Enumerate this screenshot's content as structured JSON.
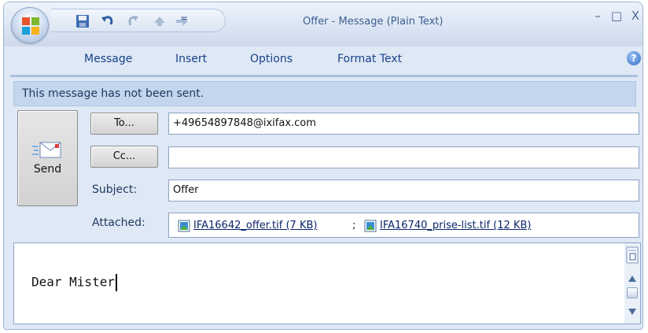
{
  "window": {
    "title": "Offer - Message (Plain Text)",
    "minimize_glyph": "–",
    "maximize_glyph": "□",
    "close_glyph": "X"
  },
  "quick_access": {
    "icons": [
      "save-icon",
      "undo-icon",
      "redo-icon",
      "previous-item-icon",
      "next-item-icon",
      "customize-dropdown-icon"
    ],
    "customize_glyph": "="
  },
  "ribbon": {
    "tabs": [
      {
        "label": "Message"
      },
      {
        "label": "Insert"
      },
      {
        "label": "Options"
      },
      {
        "label": "Format Text"
      }
    ],
    "help_glyph": "?"
  },
  "infobar": {
    "text": "This message has not been sent."
  },
  "send": {
    "label": "Send"
  },
  "to": {
    "button_label": "To...",
    "value": "+49654897848@ixifax.com"
  },
  "cc": {
    "button_label": "Cc...",
    "value": ""
  },
  "subject": {
    "label": "Subject:",
    "value": "Offer"
  },
  "attached": {
    "label": "Attached:",
    "files": [
      {
        "name": "IFA16642_offer.tif (7 KB)"
      },
      {
        "name": "IFA16740_prise-list.tif (12 KB)"
      }
    ],
    "separator": ";"
  },
  "body": {
    "text": "Dear Mister"
  },
  "colors": {
    "window_bg": "#dfe8f5",
    "infobar_bg": "#c3d6ee",
    "tab_text": "#15428b",
    "link": "#0a246a"
  }
}
